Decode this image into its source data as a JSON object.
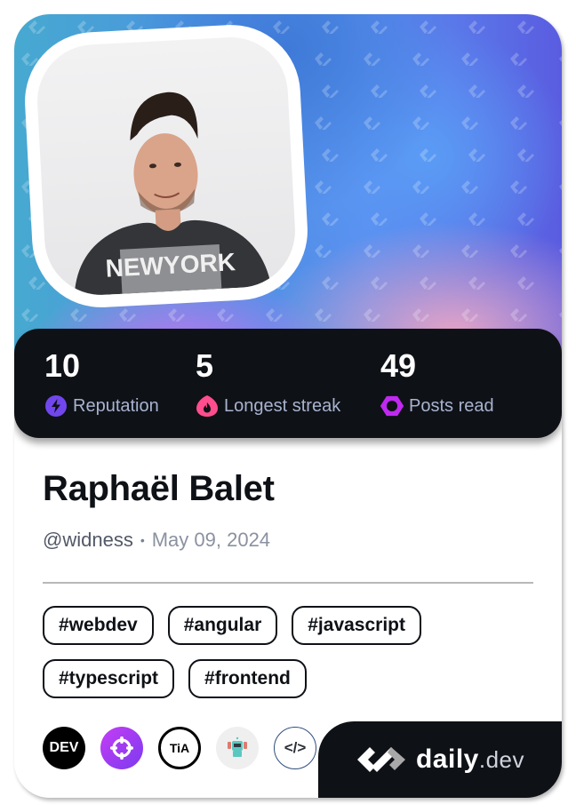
{
  "profile": {
    "name": "Raphaël Balet",
    "username": "@widness",
    "separator": "•",
    "joined_date": "May 09, 2024",
    "avatar_alt": "profile-photo",
    "shirt_text": "NEWYORK"
  },
  "stats": [
    {
      "value": "10",
      "label": "Reputation",
      "icon": "lightning-icon",
      "color": "#7147ed"
    },
    {
      "value": "5",
      "label": "Longest streak",
      "icon": "flame-icon",
      "color": "#ff4d8d"
    },
    {
      "value": "49",
      "label": "Posts read",
      "icon": "ring-icon",
      "color": "#c029f0"
    }
  ],
  "tags": [
    "#webdev",
    "#angular",
    "#javascript",
    "#typescript",
    "#frontend"
  ],
  "badges": [
    {
      "name": "dev-to-badge",
      "label": "DEV"
    },
    {
      "name": "crosshair-badge",
      "label": ""
    },
    {
      "name": "tia-badge",
      "label": "TiA"
    },
    {
      "name": "robot-badge",
      "label": ""
    },
    {
      "name": "code-badge",
      "label": "</>"
    }
  ],
  "brand": {
    "name": "daily",
    "tld": ".dev"
  },
  "colors": {
    "dark": "#0e1116",
    "stat_label": "#a8b3cf",
    "reputation": "#7147ed",
    "streak": "#ff4d8d",
    "posts": "#c029f0"
  }
}
